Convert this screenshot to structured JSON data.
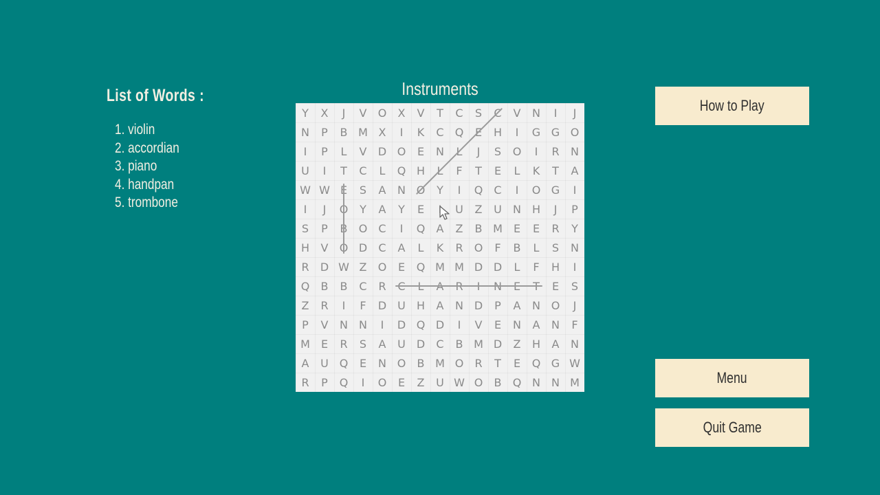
{
  "word_list": {
    "title": "List of Words :",
    "items": [
      "1. violin",
      "2. accordian",
      "3. piano",
      "4. handpan",
      "5. trombone"
    ]
  },
  "puzzle": {
    "title": "Instruments",
    "grid": [
      "YXJVOXVTCSCVNIJ",
      "NPBMXIKCQEHIGGO",
      "IPLVDOENLJSOIRN",
      "UITCLQHLFTELKTA",
      "WWESANOYIQCIOGI",
      "IJOYAYEIUZUNHJP",
      "SPBOCIQAZBMEERY",
      "HVODCALKROFBLSN",
      "RDWZOEQMMDDLFHI",
      "QBBCRCLARINETES",
      "ZRIFDUHANDPANOJ",
      "PVNNIDQDIVENANF",
      "MERSAUDCBMDZHAN",
      "AUQENOBMORTEQGW",
      "RPQIOEZUWOBQNNM"
    ],
    "found_words": [
      {
        "word": "CLARINET",
        "start": [
          9,
          5
        ],
        "end": [
          9,
          12
        ]
      },
      {
        "word": "OBOE",
        "start": [
          4,
          2
        ],
        "end": [
          7,
          2
        ]
      },
      {
        "word": "CELLO",
        "start": [
          0,
          10
        ],
        "end": [
          4,
          6
        ]
      }
    ]
  },
  "buttons": {
    "how_to_play": "How to Play",
    "menu": "Menu",
    "quit": "Quit Game"
  },
  "colors": {
    "background": "#007f7e",
    "grid_background": "#f1f1f1",
    "letter": "#8a8a8a",
    "strike": "#9a9a9a",
    "button_background": "#f8ebce",
    "button_text": "#2f2f2f",
    "panel_text": "#f3efe2"
  }
}
